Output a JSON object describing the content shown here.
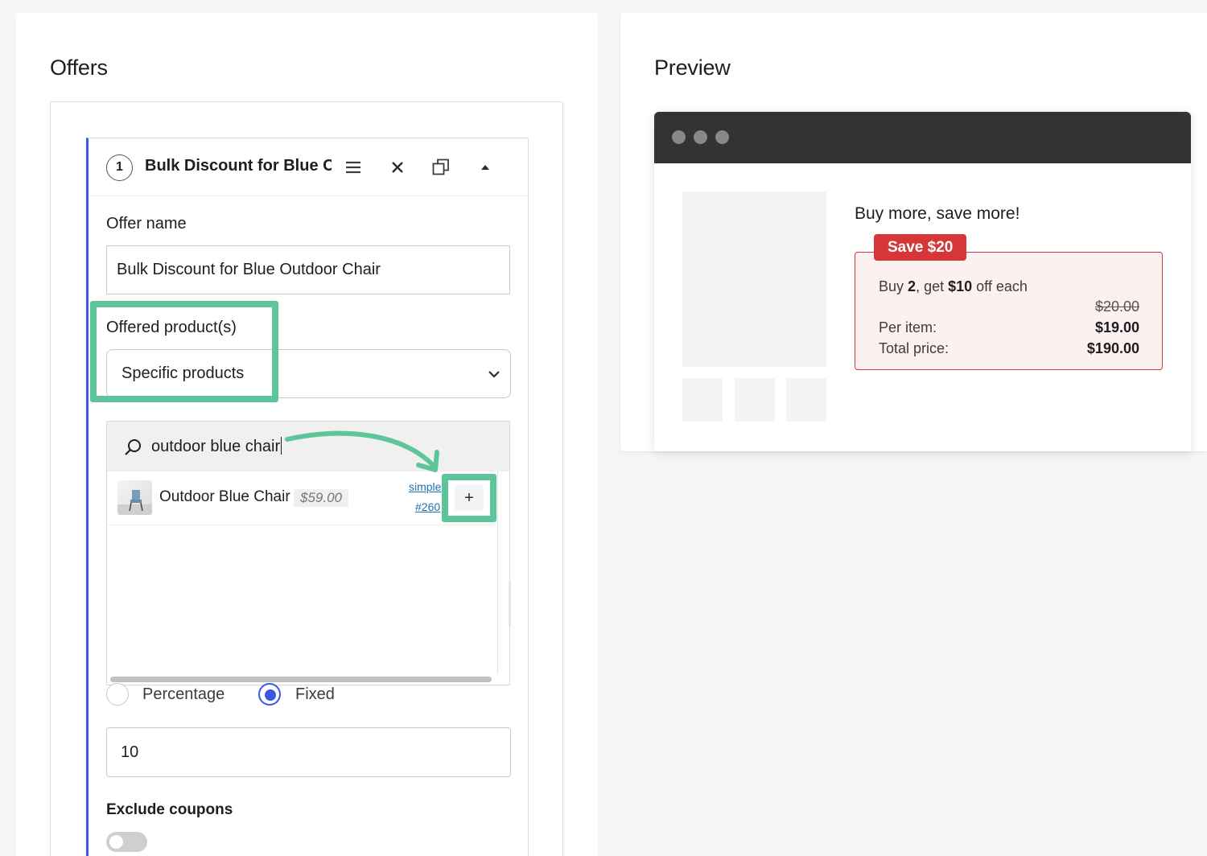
{
  "offers": {
    "title": "Offers",
    "card": {
      "step": "1",
      "title": "Bulk Discount for Blue O",
      "offer_name_label": "Offer name",
      "offer_name_value": "Bulk Discount for Blue Outdoor Chair",
      "offered_products_label": "Offered product(s)",
      "offered_products_value": "Specific products",
      "search_query": "outdoor blue chair",
      "results": [
        {
          "name": "Outdoor Blue Chair",
          "price": "$59.00",
          "type": "simple",
          "id": "#260",
          "add": "+"
        }
      ],
      "discount_types": [
        {
          "label": "Percentage",
          "checked": false
        },
        {
          "label": "Fixed",
          "checked": true
        }
      ],
      "discount_value": "10",
      "exclude_coupons_label": "Exclude coupons",
      "exclude_coupons_on": false
    }
  },
  "preview": {
    "title": "Preview",
    "headline": "Buy more, save more!",
    "badge": "Save $20",
    "deal": {
      "buy_prefix": "Buy",
      "buy_qty": "2",
      "get_text": ", get",
      "off_amount": "$10",
      "off_suffix": "off each",
      "original_price": "$20.00",
      "per_item_label": "Per item:",
      "per_item_value": "$19.00",
      "total_label": "Total price:",
      "total_value": "$190.00"
    }
  },
  "colors": {
    "accent": "#3858e9",
    "highlight": "#5ec59a",
    "sale": "#d63638"
  }
}
